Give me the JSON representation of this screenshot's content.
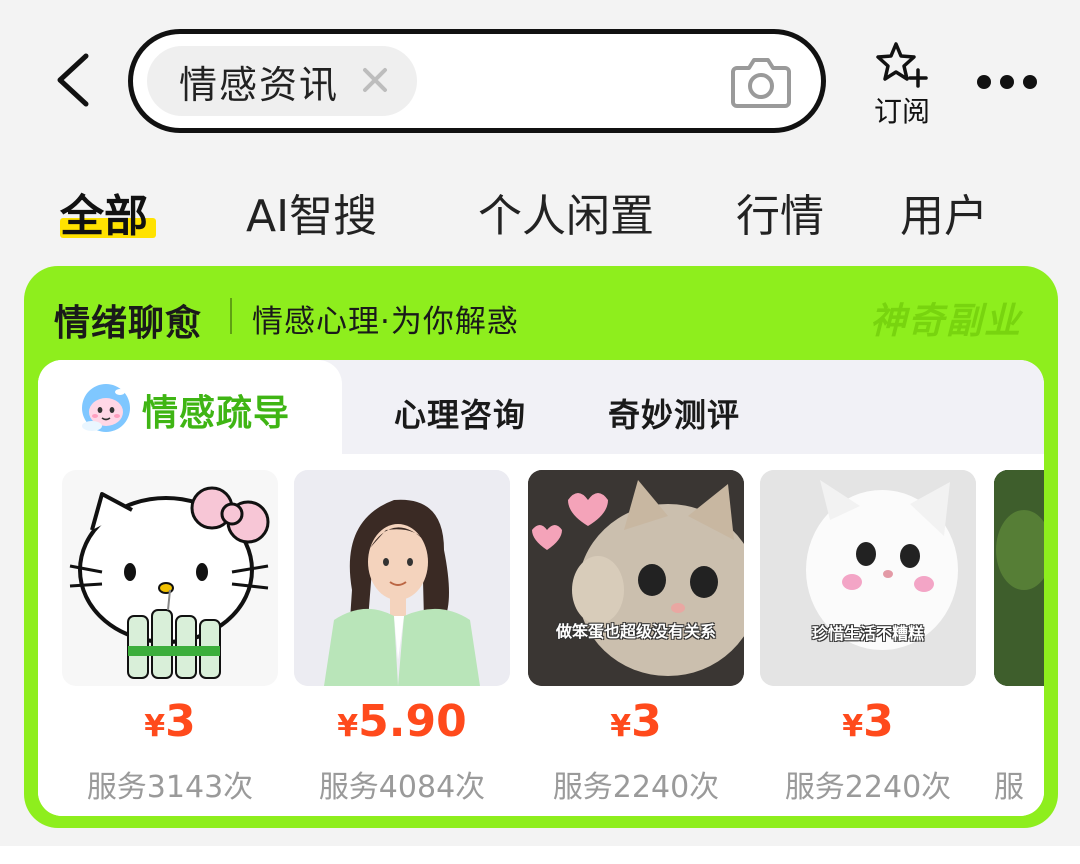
{
  "header": {
    "search_chip": "情感资讯",
    "subscribe_label": "订阅"
  },
  "tabs": [
    {
      "label": "全部",
      "active": true
    },
    {
      "label": "AI智搜",
      "active": false
    },
    {
      "label": "个人闲置",
      "active": false
    },
    {
      "label": "行情",
      "active": false
    },
    {
      "label": "用户",
      "active": false
    }
  ],
  "card": {
    "title": "情绪聊愈",
    "subtitle": "情感心理·为你解惑",
    "brand": "神奇副业",
    "subtabs": [
      {
        "label": "情感疏导",
        "active": true
      },
      {
        "label": "心理咨询",
        "active": false
      },
      {
        "label": "奇妙测评",
        "active": false
      }
    ],
    "items": [
      {
        "currency": "¥",
        "price": "3",
        "served": "服务3143次",
        "image": "hello-kitty-image",
        "caption": ""
      },
      {
        "currency": "¥",
        "price": "5.90",
        "served": "服务4084次",
        "image": "woman-illustration-image",
        "caption": ""
      },
      {
        "currency": "¥",
        "price": "3",
        "served": "服务2240次",
        "image": "cat-meme-image",
        "caption": "做笨蛋也超级没有关系"
      },
      {
        "currency": "¥",
        "price": "3",
        "served": "服务2240次",
        "image": "white-cat-meme-image",
        "caption": "珍惜生活不糟糕"
      },
      {
        "currency": "",
        "price": "",
        "served": "服",
        "image": "forest-image",
        "caption": ""
      }
    ]
  },
  "colors": {
    "accent_green": "#8eee1d",
    "active_subtab": "#3fb514",
    "price": "#ff4a1c",
    "tab_highlight": "#ffe200"
  }
}
